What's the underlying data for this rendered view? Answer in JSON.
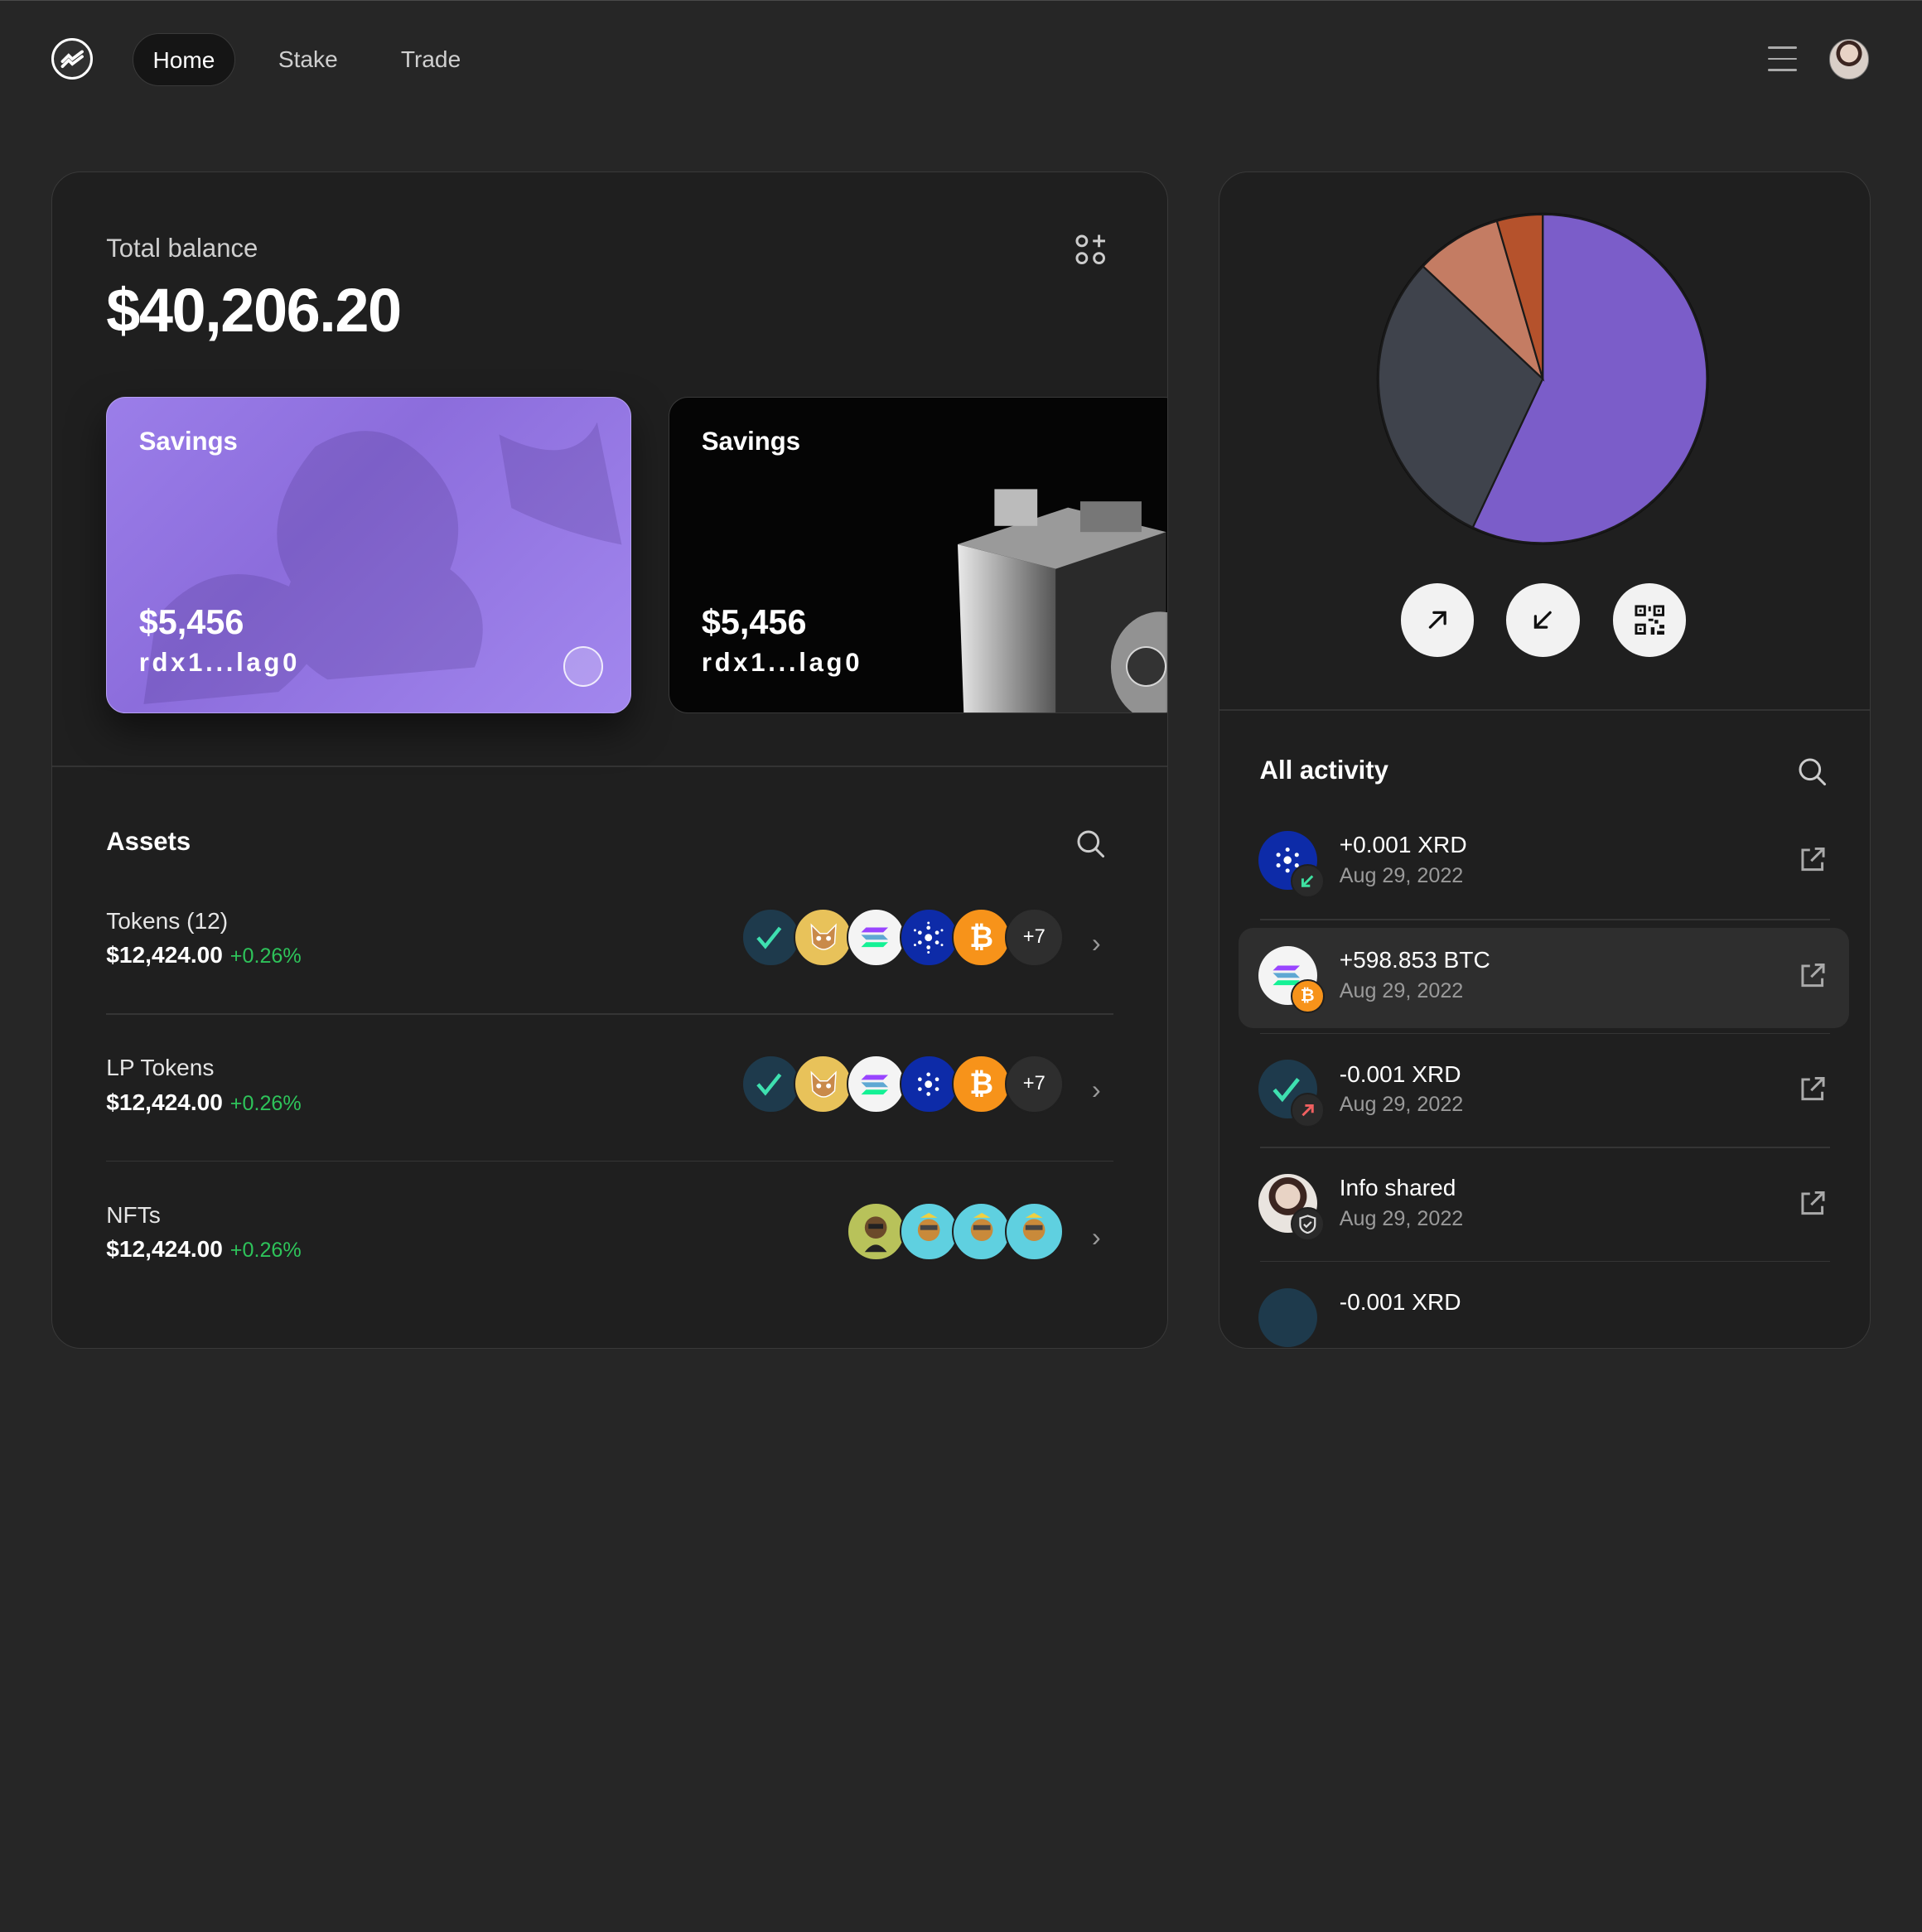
{
  "nav": {
    "tabs": [
      {
        "label": "Home",
        "active": true
      },
      {
        "label": "Stake",
        "active": false
      },
      {
        "label": "Trade",
        "active": false
      }
    ]
  },
  "balance": {
    "label": "Total balance",
    "value": "$40,206.20"
  },
  "cards": [
    {
      "title": "Savings",
      "amount": "$5,456",
      "address": "rdx1...lag0",
      "style": "purple"
    },
    {
      "title": "Savings",
      "amount": "$5,456",
      "address": "rdx1...lag0",
      "style": "black"
    }
  ],
  "assets": {
    "title": "Assets",
    "rows": [
      {
        "name": "Tokens (12)",
        "value": "$12,424.00",
        "change": "+0.26%",
        "more": "+7"
      },
      {
        "name": "LP Tokens",
        "value": "$12,424.00",
        "change": "+0.26%",
        "more": "+7"
      },
      {
        "name": "NFTs",
        "value": "$12,424.00",
        "change": "+0.26%"
      }
    ]
  },
  "portfolio_chart": {
    "type": "pie",
    "slices": [
      {
        "value": 57,
        "color": "#7b5dc9"
      },
      {
        "value": 30,
        "color": "#3f434c"
      },
      {
        "value": 8.5,
        "color": "#c47c63"
      },
      {
        "value": 4.5,
        "color": "#b5522c"
      }
    ]
  },
  "activity": {
    "title": "All activity",
    "items": [
      {
        "title": "+0.001 XRD",
        "date": "Aug 29, 2022",
        "icon": "cardano-icon",
        "badge": "receive-arrow-icon",
        "selected": false
      },
      {
        "title": "+598.853 BTC",
        "date": "Aug 29, 2022",
        "icon": "solana-icon",
        "badge": "bitcoin-icon",
        "selected": true
      },
      {
        "title": "-0.001 XRD",
        "date": "Aug 29, 2022",
        "icon": "radix-icon",
        "badge": "send-arrow-icon",
        "selected": false
      },
      {
        "title": "Info shared",
        "date": "Aug 29, 2022",
        "icon": "person-avatar-icon",
        "badge": "shield-icon",
        "selected": false
      },
      {
        "title": "-0.001 XRD",
        "date": "",
        "icon": "radix-icon",
        "badge": "",
        "selected": false
      }
    ]
  },
  "colors": {
    "accent": "#8c6ddc",
    "positive": "#2ec35a",
    "background": "#262626",
    "panel": "#1f1f1f"
  }
}
